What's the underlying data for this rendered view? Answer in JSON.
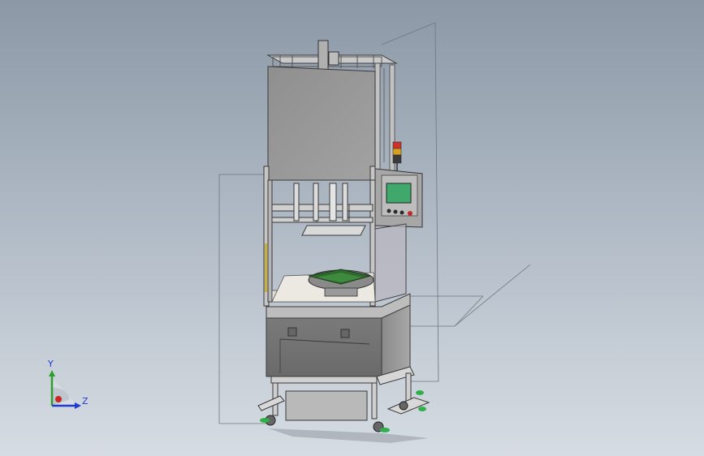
{
  "triad": {
    "y_label": "Y",
    "z_label": "Z",
    "colors": {
      "y": "#2e9e2e",
      "z": "#1f3bd1",
      "x": "#c62828"
    }
  },
  "colors": {
    "background_top": "#8c98a6",
    "background_bottom": "#d6dce2",
    "panel_fill": "#8f8f8f",
    "frame_stroke": "#3a3a3a",
    "hmi_screen": "#3fa86a",
    "pcb": "#2f6b2f",
    "guide_lines": "#6e7680"
  },
  "icons": [
    "coordinate-triad-icon"
  ]
}
